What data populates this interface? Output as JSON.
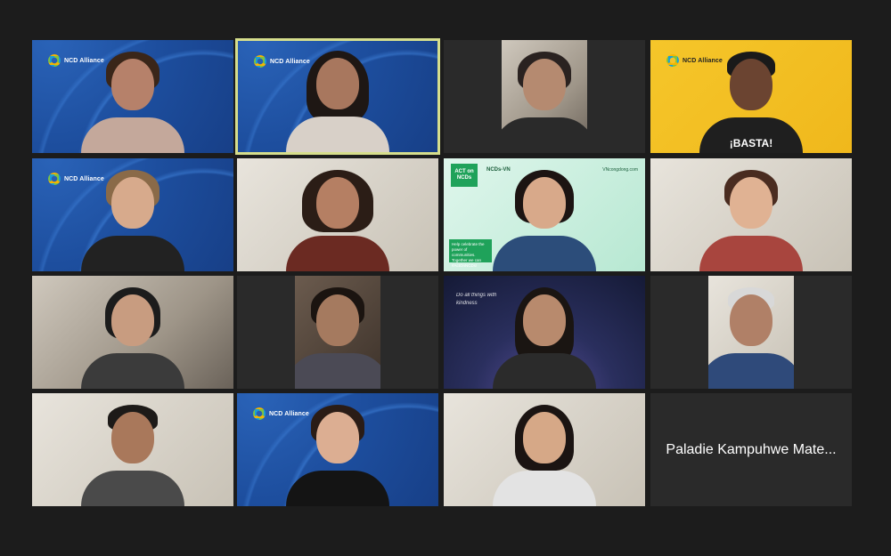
{
  "meeting": {
    "tiles": [
      {
        "id": "t1",
        "bg": "ncd",
        "logo": "NCD Alliance",
        "active": false
      },
      {
        "id": "t2",
        "bg": "ncd",
        "logo": "NCD Alliance",
        "active": true
      },
      {
        "id": "t3",
        "bg": "room",
        "logo": "",
        "active": false
      },
      {
        "id": "t4",
        "bg": "yellow",
        "logo": "NCD Alliance",
        "active": false,
        "shirt_text": "¡BASTA!"
      },
      {
        "id": "t5",
        "bg": "ncd",
        "logo": "NCD Alliance",
        "active": false
      },
      {
        "id": "t6",
        "bg": "light",
        "logo": "",
        "active": false
      },
      {
        "id": "t7",
        "bg": "green",
        "logo": "",
        "active": false,
        "act_label": "ACT on NCDs",
        "ncdvn": "NCDs-VN",
        "banner": "Help celebrate the power of communities. Together we can #ActOnNCDs!",
        "link": "VNcongdong.com"
      },
      {
        "id": "t8",
        "bg": "light",
        "logo": "",
        "active": false
      },
      {
        "id": "t9",
        "bg": "room",
        "logo": "",
        "active": false
      },
      {
        "id": "t10",
        "bg": "brown",
        "logo": "",
        "active": false
      },
      {
        "id": "t11",
        "bg": "star",
        "logo": "",
        "active": false,
        "quote": "Do all things with kindness"
      },
      {
        "id": "t12",
        "bg": "light",
        "logo": "",
        "active": false
      },
      {
        "id": "t13",
        "bg": "room",
        "logo": "",
        "active": false
      },
      {
        "id": "t14",
        "bg": "ncd",
        "logo": "NCD Alliance",
        "active": false
      },
      {
        "id": "t15",
        "bg": "light",
        "logo": "",
        "active": false
      },
      {
        "id": "t16",
        "bg": "dark",
        "logo": "",
        "active": false,
        "name": "Paladie Kampuhwe Mate..."
      }
    ]
  }
}
